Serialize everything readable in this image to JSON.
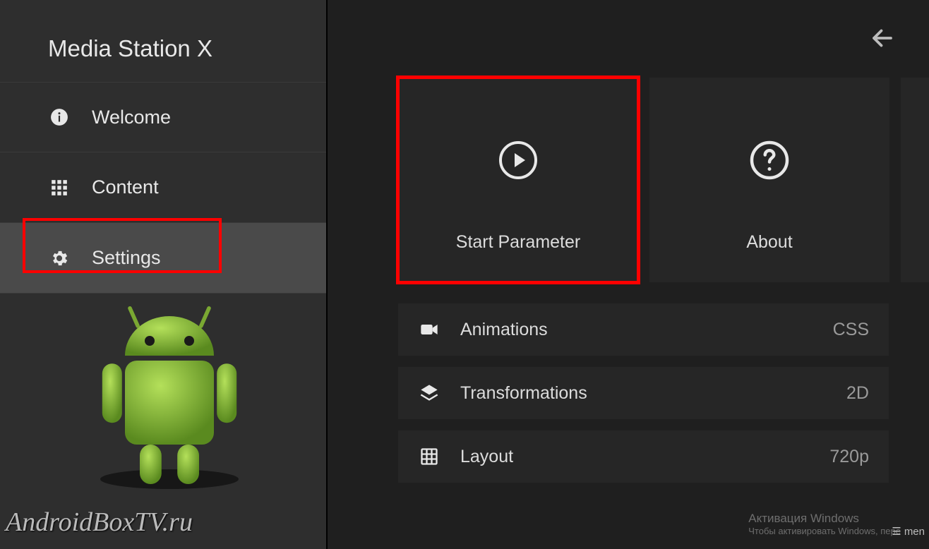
{
  "app": {
    "title": "Media Station X"
  },
  "sidebar": {
    "items": [
      {
        "label": "Welcome",
        "icon": "info-icon"
      },
      {
        "label": "Content",
        "icon": "grid-icon"
      },
      {
        "label": "Settings",
        "icon": "gear-icon"
      }
    ]
  },
  "tiles": [
    {
      "label": "Start Parameter",
      "icon": "play-icon"
    },
    {
      "label": "About",
      "icon": "help-icon"
    }
  ],
  "rows": [
    {
      "label": "Animations",
      "value": "CSS",
      "icon": "video-icon"
    },
    {
      "label": "Transformations",
      "value": "2D",
      "icon": "layers-icon"
    },
    {
      "label": "Layout",
      "value": "720p",
      "icon": "layout-grid-icon"
    }
  ],
  "watermark": "AndroidBoxTV.ru",
  "activation": {
    "title": "Активация Windows",
    "sub": "Чтобы активировать Windows, пере"
  },
  "menu_label": "men"
}
